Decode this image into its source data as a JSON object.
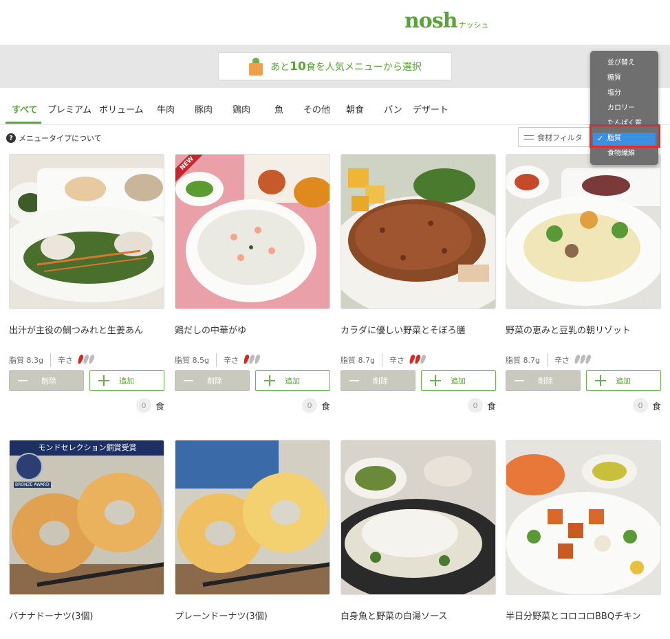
{
  "header": {
    "logo": "nosh",
    "logo_sub": "ナッシュ"
  },
  "banner": {
    "prefix": "あと",
    "count": "10",
    "suffix": "食を人気メニューから選択"
  },
  "tabs": [
    "すべて",
    "プレミアム",
    "ボリューム",
    "牛肉",
    "豚肉",
    "鶏肉",
    "魚",
    "その他",
    "朝食",
    "パン",
    "デザート"
  ],
  "info": {
    "text": "メニュータイプについて"
  },
  "filter": {
    "label": "食材フィルタ"
  },
  "sort_menu": {
    "items": [
      "並び替え",
      "糖質",
      "塩分",
      "カロリー",
      "たんぱく質",
      "脂質",
      "食物繊維"
    ],
    "selected": "脂質"
  },
  "buttons": {
    "delete": "削除",
    "add": "追加"
  },
  "labels": {
    "spice": "辛さ",
    "count_unit": "食",
    "new": "NEW"
  },
  "products": [
    {
      "name": "出汁が主役の鯛つみれと生姜あん",
      "fat": "脂質 8.3g",
      "spice": 1,
      "count": "0"
    },
    {
      "name": "鶏だしの中華がゆ",
      "fat": "脂質 8.5g",
      "spice": 1,
      "count": "0",
      "new": true
    },
    {
      "name": "カラダに優しい野菜とそぼろ膳",
      "fat": "脂質 8.7g",
      "spice": 2,
      "count": "0"
    },
    {
      "name": "野菜の恵みと豆乳の朝リゾット",
      "fat": "脂質 8.7g",
      "spice": 0,
      "count": "0"
    },
    {
      "name": "バナナドーナツ(3個)"
    },
    {
      "name": "プレーンドーナツ(3個)"
    },
    {
      "name": "白身魚と野菜の白湯ソース"
    },
    {
      "name": "半日分野菜とコロコロBBQチキン"
    }
  ],
  "award": {
    "banner": "モンドセレクション銅賞受賞",
    "badge": "BRONZE AWARD"
  },
  "colors": {
    "accent": "#5aa33a",
    "selection": "#3d8fe0",
    "highlight": "#e5282a",
    "chili": "#d42a1e",
    "chili_off": "#bbbbbb"
  }
}
